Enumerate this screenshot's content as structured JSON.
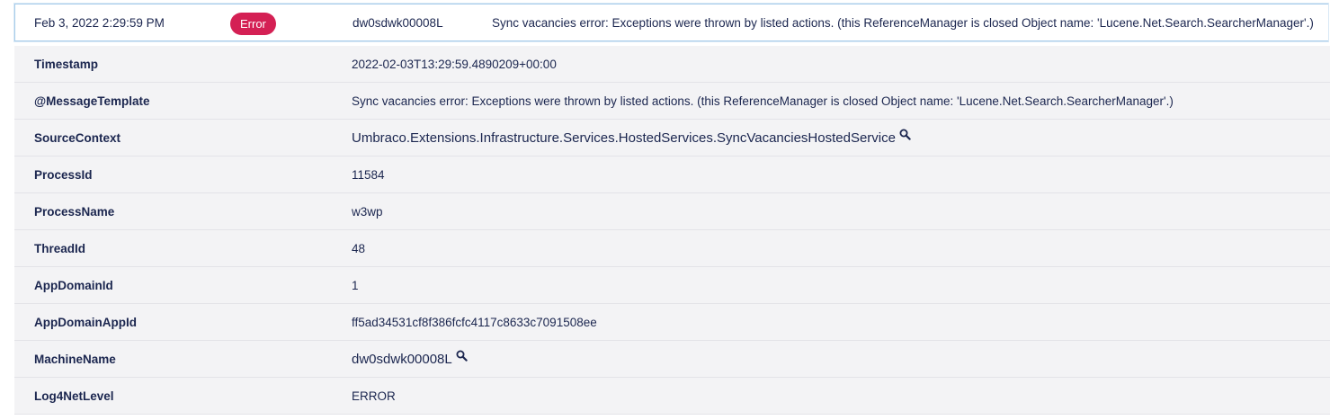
{
  "log_entry": {
    "timestamp": "Feb 3, 2022 2:29:59 PM",
    "level_badge": "Error",
    "machine": "dw0sdwk00008L",
    "message": "Sync vacancies error: Exceptions were thrown by listed actions. (this ReferenceManager is closed Object name: 'Lucene.Net.Search.SearcherManager'.)"
  },
  "colors": {
    "error_badge": "#d42054",
    "row_background": "#f3f3f5",
    "selected_border": "#a8cdea",
    "text": "#1b264f"
  },
  "properties": [
    {
      "key": "Timestamp",
      "value": "2022-02-03T13:29:59.4890209+00:00"
    },
    {
      "key": "@MessageTemplate",
      "value": "Sync vacancies error: Exceptions were thrown by listed actions. (this ReferenceManager is closed Object name: 'Lucene.Net.Search.SearcherManager'.)"
    },
    {
      "key": "SourceContext",
      "value": "Umbraco.Extensions.Infrastructure.Services.HostedServices.SyncVacanciesHostedService",
      "icon": "search-icon"
    },
    {
      "key": "ProcessId",
      "value": "11584"
    },
    {
      "key": "ProcessName",
      "value": "w3wp"
    },
    {
      "key": "ThreadId",
      "value": "48"
    },
    {
      "key": "AppDomainId",
      "value": "1"
    },
    {
      "key": "AppDomainAppId",
      "value": "ff5ad34531cf8f386fcfc4117c8633c7091508ee"
    },
    {
      "key": "MachineName",
      "value": "dw0sdwk00008L",
      "icon": "search-icon"
    },
    {
      "key": "Log4NetLevel",
      "value": "ERROR"
    }
  ]
}
